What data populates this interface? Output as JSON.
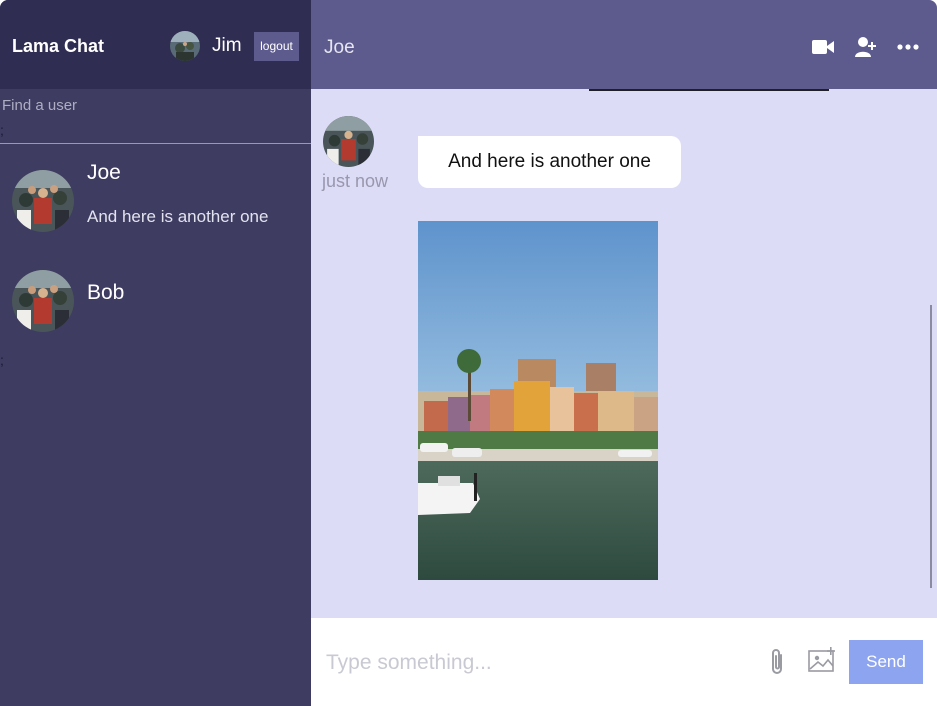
{
  "app": {
    "title": "Lama Chat"
  },
  "current_user": {
    "name": "Jim",
    "logout_label": "logout"
  },
  "search": {
    "placeholder": "Find a user",
    "value": ""
  },
  "sidebar": {
    "stray_glyph_1": ";",
    "stray_glyph_2": ";",
    "chats": [
      {
        "name": "Joe",
        "last_message": "And here is another one"
      },
      {
        "name": "Bob",
        "last_message": ""
      }
    ]
  },
  "chat": {
    "title": "Joe",
    "header_icons": [
      "video-camera-icon",
      "add-user-icon",
      "more-icon"
    ],
    "messages": [
      {
        "text": "And here is another one",
        "time": "just now",
        "has_image": true
      }
    ]
  },
  "composer": {
    "placeholder": "Type something...",
    "attach_icon": "paperclip-icon",
    "image_icon": "image-icon",
    "send_label": "Send"
  },
  "colors": {
    "sidebar": "#3e3c61",
    "navbar": "#2f2d52",
    "chat_header": "#5d5b8d",
    "messages_bg": "#dddcf7",
    "send_button": "#8da4f1"
  }
}
